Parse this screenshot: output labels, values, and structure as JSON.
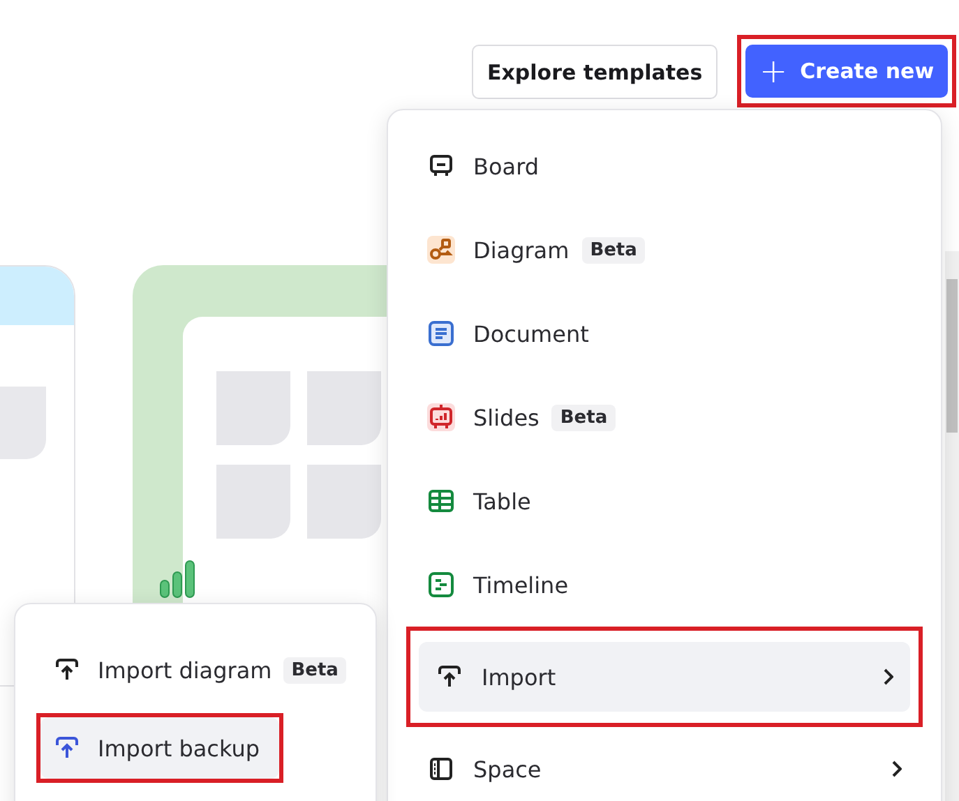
{
  "header": {
    "explore_button": "Explore templates",
    "create_button": {
      "icon": "+",
      "label": "Create new",
      "highlighted": true
    }
  },
  "create_menu": {
    "items": [
      {
        "label": "Board",
        "kind": "item",
        "color": "#222222",
        "highlighted": false,
        "hovered": false
      },
      {
        "label": "Diagram",
        "badge": "Beta",
        "kind": "item",
        "color": "#b35c12",
        "highlighted": false,
        "hovered": false
      },
      {
        "label": "Document",
        "kind": "item",
        "color": "#3a6fd0",
        "highlighted": false,
        "hovered": false
      },
      {
        "label": "Slides",
        "badge": "Beta",
        "kind": "item",
        "color": "#d0262b",
        "highlighted": false,
        "hovered": false
      },
      {
        "label": "Table",
        "kind": "item",
        "color": "#148a3e",
        "highlighted": false,
        "hovered": false
      },
      {
        "label": "Timeline",
        "kind": "item",
        "color": "#148a3e",
        "highlighted": false,
        "hovered": false
      },
      {
        "label": "Import",
        "kind": "submenu",
        "color": "#222222",
        "highlighted": true,
        "hovered": true
      },
      {
        "label": "Space",
        "kind": "submenu",
        "color": "#222222",
        "highlighted": false,
        "hovered": false
      }
    ]
  },
  "import_submenu": {
    "items": [
      {
        "label": "Import diagram",
        "badge": "Beta",
        "color": "#222222",
        "highlighted": false,
        "hovered": false
      },
      {
        "label": "Import backup",
        "color": "#3b55d9",
        "highlighted": true,
        "hovered": true
      }
    ]
  }
}
